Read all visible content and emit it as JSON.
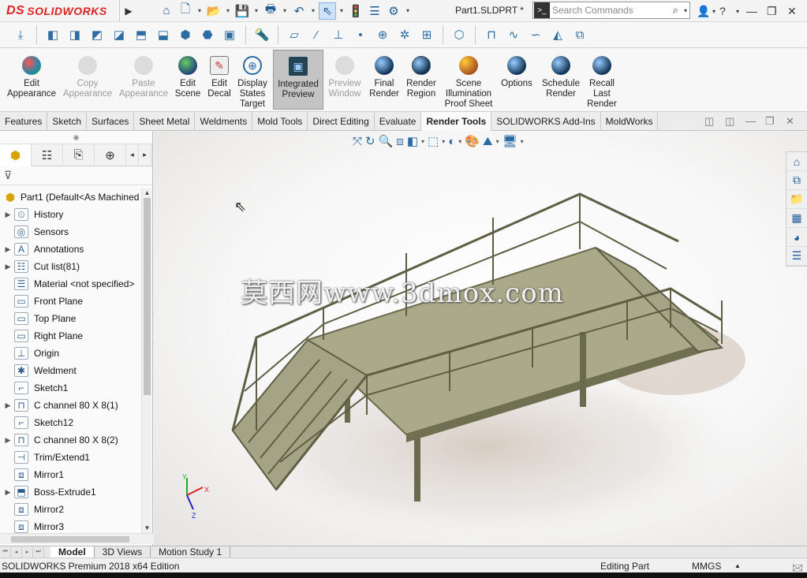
{
  "app": {
    "brand": "SOLIDWORKS",
    "brand_prefix": "DS",
    "doc_title": "Part1.SLDPRT *"
  },
  "search": {
    "placeholder": "Search Commands"
  },
  "ribbon": {
    "buttons": [
      {
        "label": "Edit\nAppearance",
        "state": "enabled"
      },
      {
        "label": "Copy\nAppearance",
        "state": "disabled"
      },
      {
        "label": "Paste\nAppearance",
        "state": "disabled"
      },
      {
        "label": "Edit\nScene",
        "state": "enabled"
      },
      {
        "label": "Edit\nDecal",
        "state": "enabled"
      },
      {
        "label": "Display\nStates\nTarget",
        "state": "enabled"
      },
      {
        "label": "Integrated\nPreview",
        "state": "active"
      },
      {
        "label": "Preview\nWindow",
        "state": "disabled"
      },
      {
        "label": "Final\nRender",
        "state": "enabled"
      },
      {
        "label": "Render\nRegion",
        "state": "enabled"
      },
      {
        "label": "Scene\nIllumination\nProof Sheet",
        "state": "enabled"
      },
      {
        "label": "Options",
        "state": "enabled"
      },
      {
        "label": "Schedule\nRender",
        "state": "enabled"
      },
      {
        "label": "Recall\nLast\nRender",
        "state": "enabled"
      }
    ]
  },
  "tabs": [
    "Features",
    "Sketch",
    "Surfaces",
    "Sheet Metal",
    "Weldments",
    "Mold Tools",
    "Direct Editing",
    "Evaluate",
    "Render Tools",
    "SOLIDWORKS Add-Ins",
    "MoldWorks"
  ],
  "active_tab": "Render Tools",
  "tree": {
    "root": "Part1  (Default<As Machined",
    "items": [
      {
        "label": "History",
        "expandable": true,
        "icon": "history-icon"
      },
      {
        "label": "Sensors",
        "expandable": false,
        "icon": "sensors-icon"
      },
      {
        "label": "Annotations",
        "expandable": true,
        "icon": "annotations-icon"
      },
      {
        "label": "Cut list(81)",
        "expandable": true,
        "icon": "cut-list-icon"
      },
      {
        "label": "Material <not specified>",
        "expandable": false,
        "icon": "material-icon"
      },
      {
        "label": "Front Plane",
        "expandable": false,
        "icon": "plane-icon"
      },
      {
        "label": "Top Plane",
        "expandable": false,
        "icon": "plane-icon"
      },
      {
        "label": "Right Plane",
        "expandable": false,
        "icon": "plane-icon"
      },
      {
        "label": "Origin",
        "expandable": false,
        "icon": "origin-icon"
      },
      {
        "label": "Weldment",
        "expandable": false,
        "icon": "weldment-icon"
      },
      {
        "label": "Sketch1",
        "expandable": false,
        "icon": "sketch-icon"
      },
      {
        "label": "C channel 80 X 8(1)",
        "expandable": true,
        "icon": "structural-member-icon"
      },
      {
        "label": "Sketch12",
        "expandable": false,
        "icon": "sketch-icon"
      },
      {
        "label": "C channel 80 X 8(2)",
        "expandable": true,
        "icon": "structural-member-icon"
      },
      {
        "label": "Trim/Extend1",
        "expandable": false,
        "icon": "trim-extend-icon"
      },
      {
        "label": "Mirror1",
        "expandable": false,
        "icon": "mirror-icon"
      },
      {
        "label": "Boss-Extrude1",
        "expandable": true,
        "icon": "extrude-icon"
      },
      {
        "label": "Mirror2",
        "expandable": false,
        "icon": "mirror-icon"
      },
      {
        "label": "Mirror3",
        "expandable": false,
        "icon": "mirror-icon"
      }
    ]
  },
  "watermark": "莫西网www.3dmox.com",
  "bottom_tabs": [
    "Model",
    "3D Views",
    "Motion Study 1"
  ],
  "active_bottom_tab": "Model",
  "status": {
    "edition": "SOLIDWORKS Premium 2018 x64 Edition",
    "mode": "Editing Part",
    "units": "MMGS"
  },
  "triad": {
    "x": "X",
    "y": "Y",
    "z": "Z"
  },
  "colors": {
    "model": "#9a9a78",
    "accent": "#2a6ba6",
    "brand": "#d22222"
  }
}
